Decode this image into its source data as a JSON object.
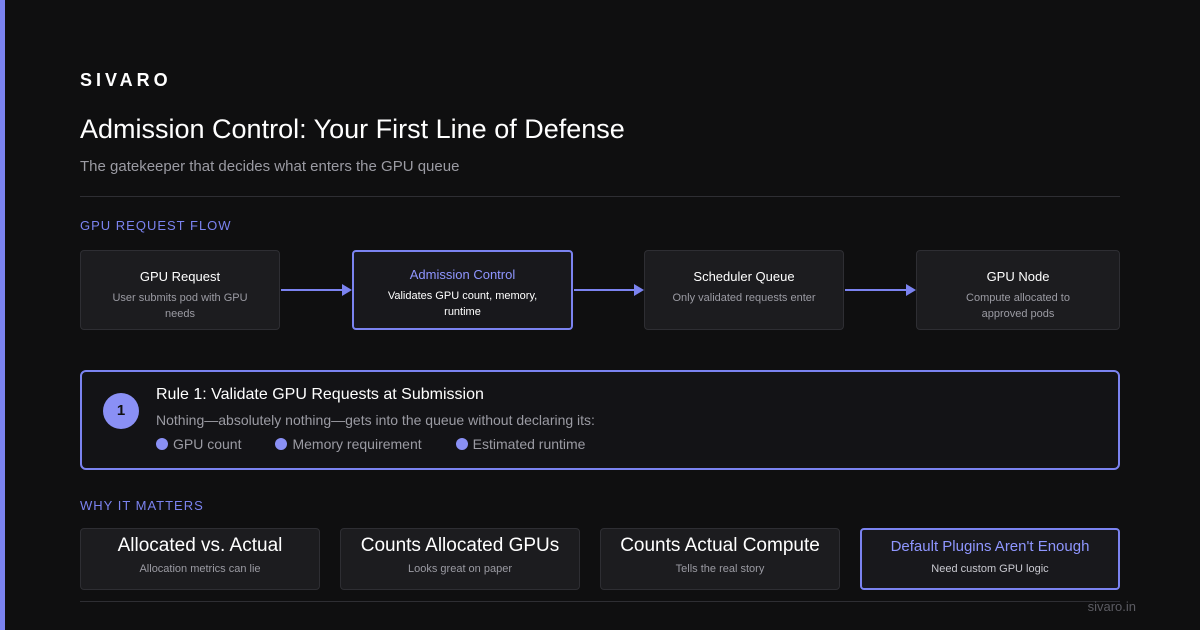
{
  "brand": "SIVARO",
  "title": "Admission Control: Your First Line of Defense",
  "subtitle": "The gatekeeper that decides what enters the GPU queue",
  "flow": {
    "section_label": "GPU REQUEST FLOW",
    "steps": [
      {
        "title": "GPU Request",
        "desc": "User submits pod with GPU needs"
      },
      {
        "title": "Admission Control",
        "desc": "Validates GPU count, memory, runtime"
      },
      {
        "title": "Scheduler Queue",
        "desc": "Only validated requests enter"
      },
      {
        "title": "GPU Node",
        "desc": "Compute allocated to approved pods"
      }
    ]
  },
  "rule": {
    "number": "1",
    "title": "Rule 1: Validate GPU Requests at Submission",
    "desc": "Nothing—absolutely nothing—gets into the queue without declaring its:",
    "items": [
      "GPU count",
      "Memory requirement",
      "Estimated runtime"
    ]
  },
  "matters": {
    "section_label": "WHY IT MATTERS",
    "cards": [
      {
        "title": "Allocated vs. Actual",
        "desc": "Allocation metrics can lie"
      },
      {
        "title": "Counts Allocated GPUs",
        "desc": "Looks great on paper"
      },
      {
        "title": "Counts Actual Compute",
        "desc": "Tells the real story"
      },
      {
        "title": "Default Plugins Aren't Enough",
        "desc": "Need custom GPU logic"
      }
    ]
  },
  "footer_url": "sivaro.in",
  "colors": {
    "accent": "#7b83f0",
    "background": "#0f0f10",
    "card": "#1c1c1f"
  }
}
